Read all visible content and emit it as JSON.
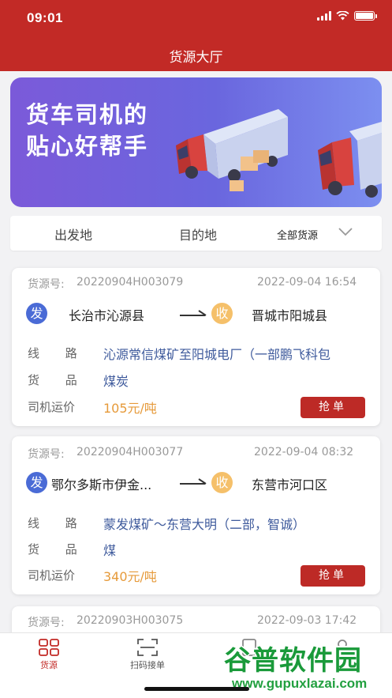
{
  "status_bar": {
    "time": "09:01"
  },
  "header": {
    "title": "货源大厅"
  },
  "banner": {
    "line1": "货车司机的",
    "line2": "贴心好帮手"
  },
  "filter": {
    "origin": "出发地",
    "destination": "目的地",
    "cargo_type": "全部货源"
  },
  "labels": {
    "source_no": "货源号:",
    "route": "线 路",
    "goods": "货 品",
    "price": "司机运价",
    "from_tag": "发",
    "to_tag": "收",
    "grab": "抢单"
  },
  "cards": [
    {
      "source_no": "20220904H003079",
      "datetime": "2022-09-04 16:54",
      "from": "长治市沁源县",
      "to": "晋城市阳城县",
      "route": "沁源常信煤矿至阳城电厂（一部鹏飞科包",
      "goods": "煤炭",
      "price": "105元/吨"
    },
    {
      "source_no": "20220904H003077",
      "datetime": "2022-09-04 08:32",
      "from": "鄂尔多斯市伊金...",
      "to": "东营市河口区",
      "route": "蒙发煤矿～东营大明（二部，智诚）",
      "goods": "煤",
      "price": "340元/吨"
    },
    {
      "source_no": "20220903H003075",
      "datetime": "2022-09-03 17:42"
    }
  ],
  "tabbar": {
    "tab1": "货源",
    "tab2": "扫码接单"
  },
  "watermark": {
    "text": "谷普软件园",
    "url": "www.gupuxlazai.com"
  },
  "colors": {
    "brand_red": "#c22a26",
    "route_blue": "#3e5a9c",
    "price_orange": "#e69a3a"
  }
}
